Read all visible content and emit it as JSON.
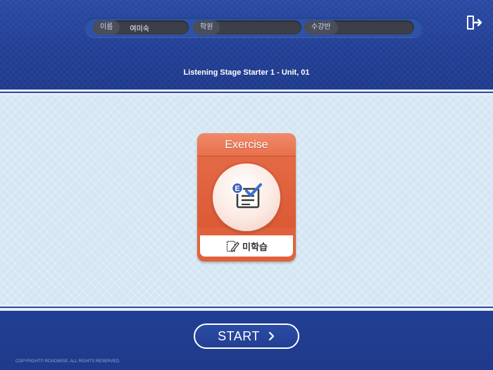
{
  "header": {
    "name_label": "이름",
    "name_value": "여미숙",
    "academy_label": "학원",
    "academy_value": "",
    "class_label": "수강반",
    "class_value": "",
    "exit_icon": "exit-door-icon"
  },
  "title": "Listening Stage Starter 1 - Unit, 01",
  "card": {
    "title": "Exercise",
    "icon": "exercise-checklist-icon",
    "badge_letter": "E",
    "status_icon": "notepad-pencil-icon",
    "status": "미학습",
    "color": "#e0623d"
  },
  "start_button": {
    "label": "START",
    "icon": "chevron-right-icon"
  },
  "footer": {
    "copyright": "COPYRIGHT© ROADWISE. ALL RIGHTS RESERVED."
  },
  "colors": {
    "brand_blue": "#213f95",
    "content_bg": "#d5e6f3",
    "accent_orange": "#e0623d"
  }
}
